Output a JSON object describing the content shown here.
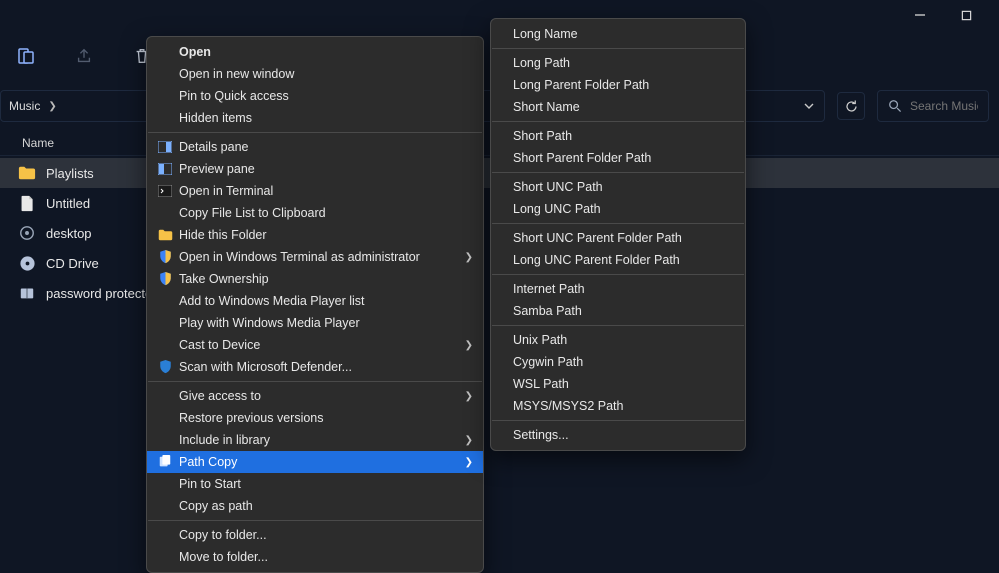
{
  "titlebar": {},
  "breadcrumb": {
    "crumb1": "Music"
  },
  "search": {
    "placeholder": "Search Music"
  },
  "columns": {
    "name": "Name"
  },
  "files": [
    {
      "label": "Playlists"
    },
    {
      "label": "Untitled"
    },
    {
      "label": "desktop"
    },
    {
      "label": "CD Drive"
    },
    {
      "label": "password protected."
    }
  ],
  "ctx1": {
    "open": "Open",
    "open_new_window": "Open in new window",
    "pin_quick": "Pin to Quick access",
    "hidden_items": "Hidden items",
    "details_pane": "Details pane",
    "preview_pane": "Preview pane",
    "open_terminal": "Open in Terminal",
    "copy_file_list": "Copy File List to Clipboard",
    "hide_folder": "Hide this Folder",
    "open_wt_admin": "Open in Windows Terminal as administrator",
    "take_ownership": "Take Ownership",
    "add_wmp_list": "Add to Windows Media Player list",
    "play_wmp": "Play with Windows Media Player",
    "cast": "Cast to Device",
    "scan_defender": "Scan with Microsoft Defender...",
    "give_access": "Give access to",
    "restore_prev": "Restore previous versions",
    "include_library": "Include in library",
    "path_copy": "Path Copy",
    "pin_start": "Pin to Start",
    "copy_as_path": "Copy as path",
    "copy_to_folder": "Copy to folder...",
    "move_to_folder": "Move to folder..."
  },
  "ctx2": {
    "long_name": "Long Name",
    "long_path": "Long Path",
    "long_parent": "Long Parent Folder Path",
    "short_name": "Short Name",
    "short_path": "Short Path",
    "short_parent": "Short Parent Folder Path",
    "short_unc": "Short UNC Path",
    "long_unc": "Long UNC Path",
    "short_unc_parent": "Short UNC Parent Folder Path",
    "long_unc_parent": "Long UNC Parent Folder Path",
    "internet_path": "Internet Path",
    "samba_path": "Samba Path",
    "unix_path": "Unix Path",
    "cygwin_path": "Cygwin Path",
    "wsl_path": "WSL Path",
    "msys_path": "MSYS/MSYS2 Path",
    "settings": "Settings..."
  }
}
